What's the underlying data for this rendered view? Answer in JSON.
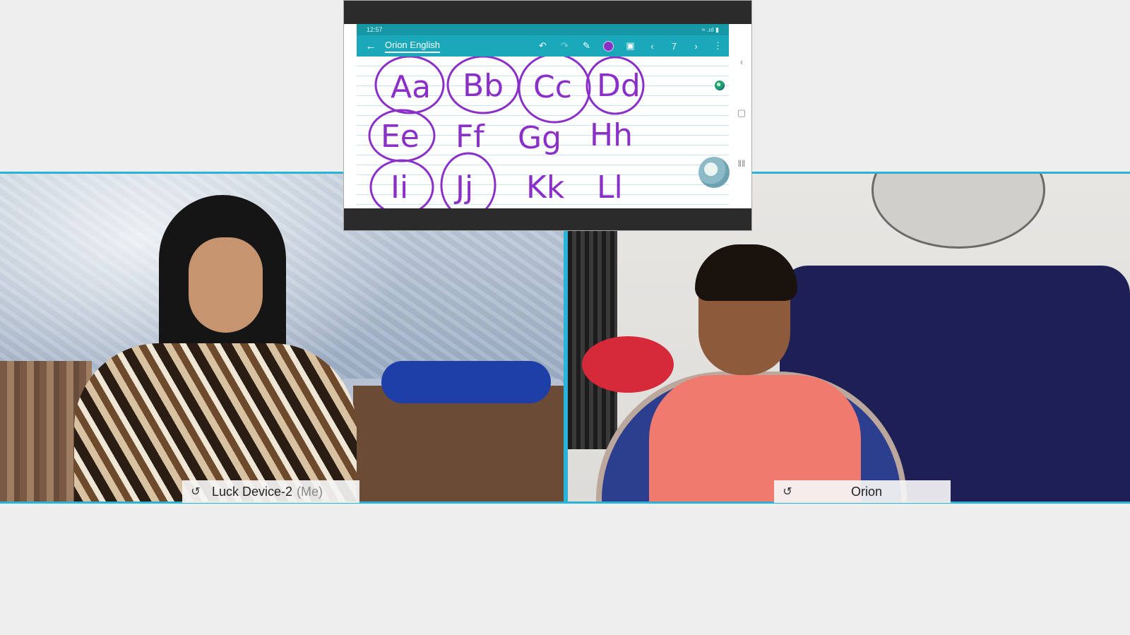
{
  "participants": [
    {
      "name": "Luck Device-2",
      "suffix": "(Me)"
    },
    {
      "name": "Orion",
      "suffix": ""
    }
  ],
  "shared_screen": {
    "status_time": "12:57",
    "status_right": "≈ .ııl ▮",
    "app_title": "Orion English",
    "page_number": "7",
    "pen_color": "#8b2fc9",
    "handwriting": {
      "row1": [
        "Aa",
        "Bb",
        "Cc",
        "Dd"
      ],
      "row2": [
        "Ee",
        "Ff",
        "Gg",
        "Hh"
      ],
      "row3": [
        "Ii",
        "Jj",
        "Kk",
        "Ll"
      ]
    }
  },
  "accent_color": "#29b3d8"
}
